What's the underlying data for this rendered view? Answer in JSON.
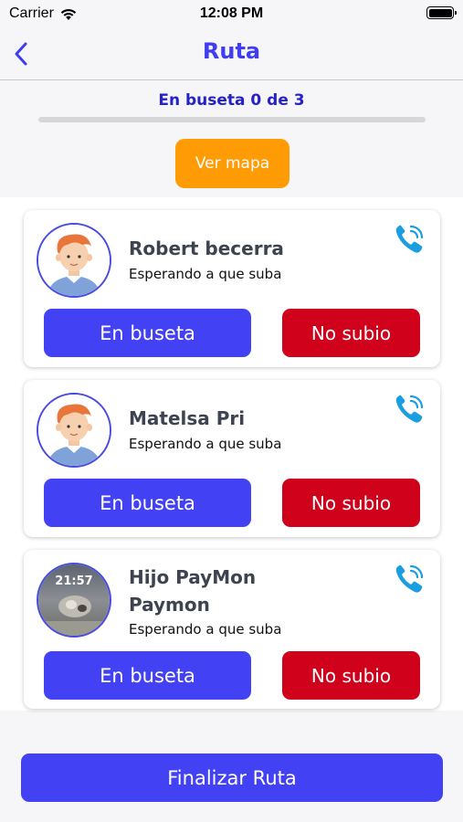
{
  "status_bar": {
    "carrier": "Carrier",
    "time": "12:08 PM",
    "icons": [
      "wifi-icon",
      "battery-icon"
    ]
  },
  "nav": {
    "title": "Ruta",
    "back_icon": "chevron-left-icon"
  },
  "progress": {
    "label": "En buseta 0 de 3",
    "boarded": 0,
    "total": 3,
    "fraction": 0
  },
  "map_button": "Ver mapa",
  "passengers": [
    {
      "name": "Robert becerra",
      "status": "Esperando a que suba",
      "avatar": "cartoon-boy-avatar",
      "on_bus_label": "En buseta",
      "not_boarded_label": "No subio"
    },
    {
      "name": "Matelsa Pri",
      "status": "Esperando a que suba",
      "avatar": "cartoon-boy-avatar",
      "on_bus_label": "En buseta",
      "not_boarded_label": "No subio"
    },
    {
      "name": "Hijo PayMon Paymon",
      "status": "Esperando a que suba",
      "avatar": "photo-avatar",
      "avatar_text": "21:57",
      "on_bus_label": "En buseta",
      "not_boarded_label": "No subio"
    }
  ],
  "finish_button": "Finalizar Ruta",
  "colors": {
    "primary": "#4341f4",
    "title": "#3f3df2",
    "accent_orange": "#ff9b05",
    "danger": "#d0021b",
    "phone": "#1a9ee0"
  }
}
